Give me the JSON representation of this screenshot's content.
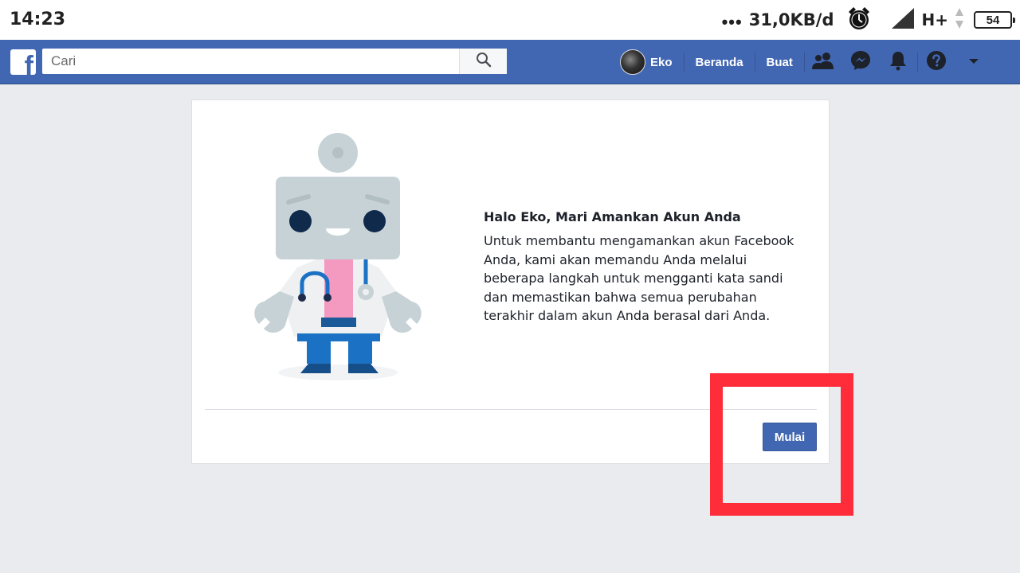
{
  "status_bar": {
    "time": "14:23",
    "dots": "•••",
    "speed": "31,0KB/d",
    "network": "H+",
    "battery": "54",
    "icons": [
      "alarm-icon",
      "signal-icon",
      "data-arrows-icon",
      "battery-icon"
    ]
  },
  "topbar": {
    "logo": "f",
    "search_placeholder": "Cari",
    "search_value": "",
    "profile_name": "Eko",
    "links": [
      "Beranda",
      "Buat"
    ],
    "icons": [
      "friends-icon",
      "messenger-icon",
      "notifications-icon",
      "help-icon",
      "menu-dropdown-icon"
    ],
    "bar_color": "#4267b2"
  },
  "card": {
    "title": "Halo Eko, Mari Amankan Akun Anda",
    "description": "Untuk membantu mengamankan akun Facebook Anda, kami akan memandu Anda melalui beberapa langkah untuk mengganti kata sandi dan memastikan bahwa semua perubahan terakhir dalam akun Anda berasal dari Anda.",
    "button_label": "Mulai",
    "illustration": "robot-doctor-illustration"
  },
  "highlight_color": "#fe2d39"
}
